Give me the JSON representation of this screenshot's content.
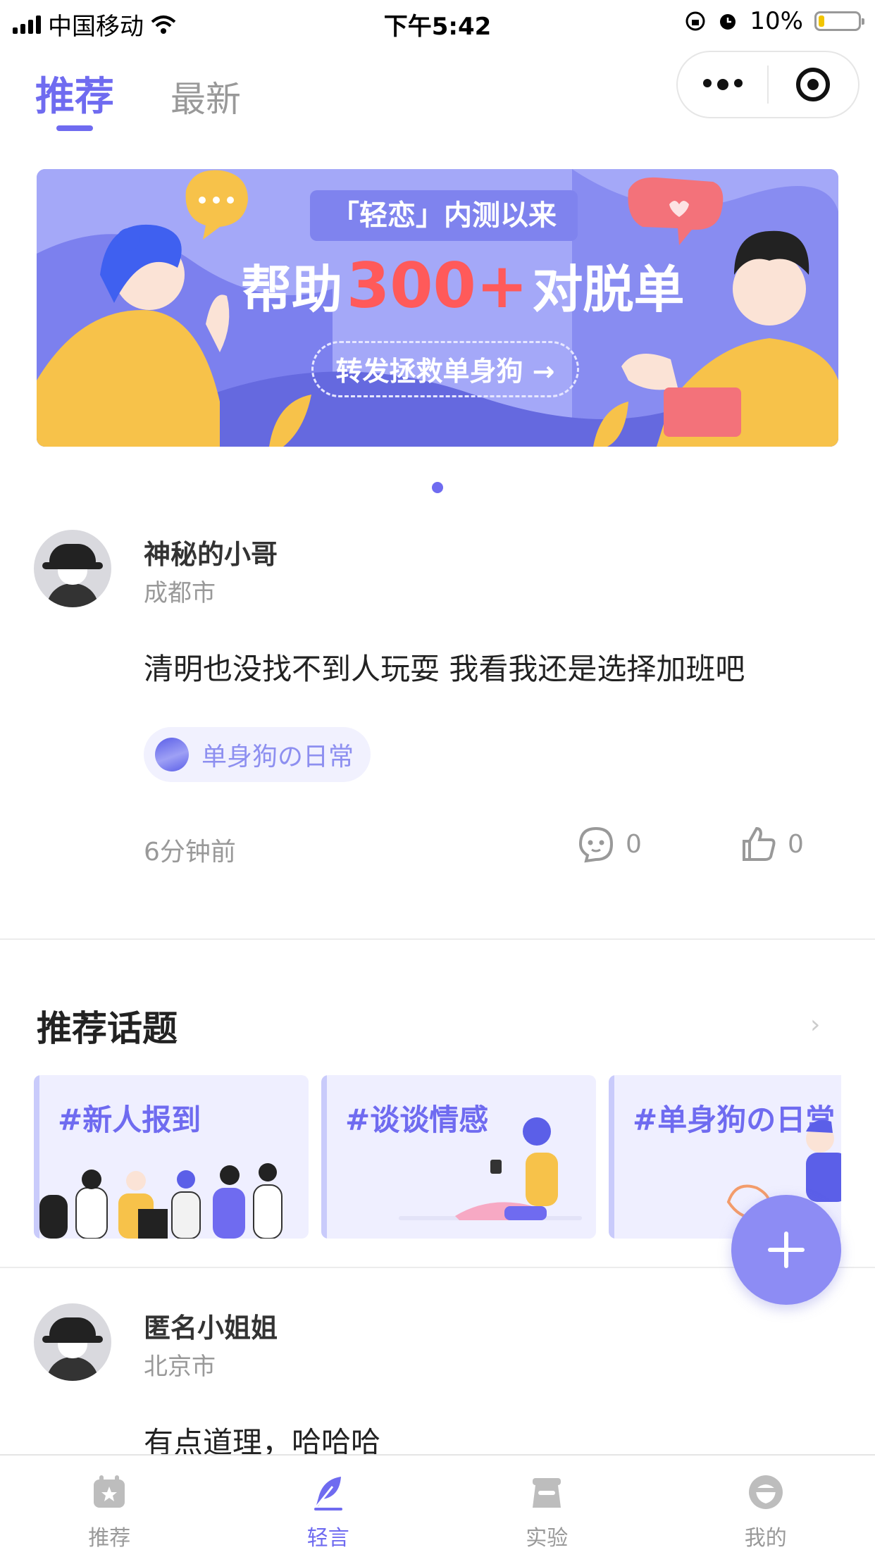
{
  "status_bar": {
    "carrier": "中国移动",
    "time": "下午5:42",
    "battery": "10%"
  },
  "tabs": [
    {
      "label": "推荐",
      "active": true
    },
    {
      "label": "最新",
      "active": false
    }
  ],
  "banner": {
    "pill": "「轻恋」内测以来",
    "headline_pre": "帮助",
    "headline_num": "300+",
    "headline_post": "对脱单",
    "cta": "转发拯救单身狗 →"
  },
  "posts": [
    {
      "name": "神秘的小哥",
      "city": "成都市",
      "content": "清明也没找不到人玩耍 我看我还是选择加班吧",
      "topic": "单身狗の日常",
      "time": "6分钟前",
      "comments": "0",
      "likes": "0"
    },
    {
      "name": "匿名小姐姐",
      "city": "北京市",
      "content": "有点道理，哈哈哈"
    }
  ],
  "recommended": {
    "title": "推荐话题",
    "topics": [
      "#新人报到",
      "#谈谈情感",
      "#单身狗の日常"
    ]
  },
  "bottom_nav": [
    {
      "label": "推荐",
      "icon": "calendar-star-icon",
      "active": false
    },
    {
      "label": "轻言",
      "icon": "feather-icon",
      "active": true
    },
    {
      "label": "实验",
      "icon": "lab-icon",
      "active": false
    },
    {
      "label": "我的",
      "icon": "profile-icon",
      "active": false
    }
  ],
  "colors": {
    "accent": "#6f6bf0",
    "fab": "#8d8cf4",
    "banner": "#9fa3f7"
  }
}
